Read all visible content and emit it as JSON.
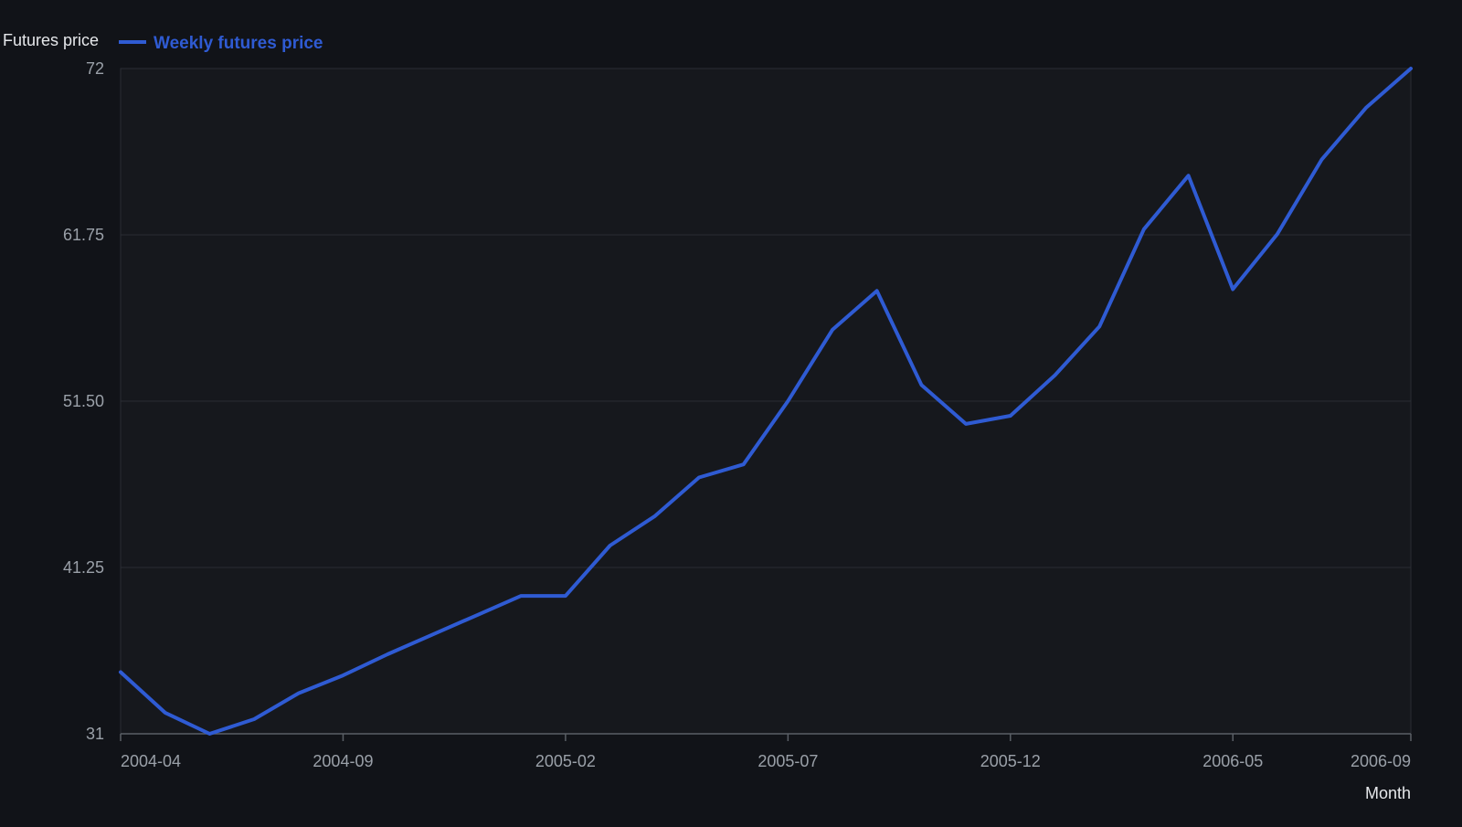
{
  "chart_data": {
    "type": "line",
    "ylabel": "Futures price",
    "xlabel": "Month",
    "ylim": [
      31,
      72
    ],
    "yticks": [
      "31",
      "41.25",
      "51.50",
      "61.75",
      "72"
    ],
    "xticks": [
      "2004-04",
      "2004-09",
      "2005-02",
      "2005-07",
      "2005-12",
      "2006-05",
      "2006-09"
    ],
    "grid": true,
    "legend_position": "top-left",
    "series": [
      {
        "name": "Weekly futures price",
        "color": "#2f5bd3",
        "x": [
          "2004-04",
          "2004-05",
          "2004-06",
          "2004-07",
          "2004-08",
          "2004-09",
          "2004-10",
          "2004-11",
          "2004-12",
          "2005-01",
          "2005-02",
          "2005-03",
          "2005-04",
          "2005-05",
          "2005-06",
          "2005-07",
          "2005-08",
          "2005-09",
          "2005-10",
          "2005-11",
          "2005-12",
          "2006-01",
          "2006-02",
          "2006-03",
          "2006-04",
          "2006-05",
          "2006-06",
          "2006-07",
          "2006-08",
          "2006-09"
        ],
        "values": [
          34.8,
          32.3,
          31.0,
          31.9,
          33.5,
          34.6,
          35.9,
          37.1,
          38.3,
          39.5,
          39.5,
          42.6,
          44.4,
          46.8,
          47.6,
          51.5,
          55.9,
          58.3,
          52.5,
          50.1,
          50.6,
          53.1,
          56.1,
          62.1,
          65.4,
          58.4,
          61.8,
          66.4,
          69.6,
          72.0
        ]
      }
    ]
  }
}
